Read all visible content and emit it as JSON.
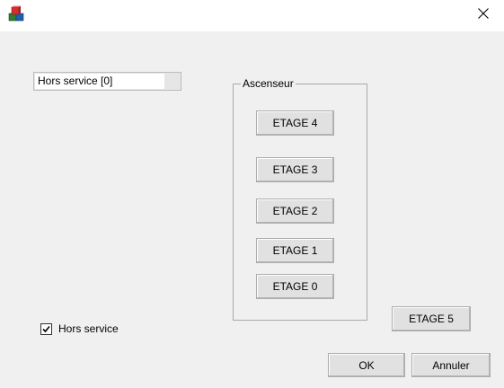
{
  "window": {
    "icon": "app-blocks-icon",
    "close_icon": "close-icon"
  },
  "status_field": {
    "value": "Hors service [0]"
  },
  "elevator_group": {
    "label": "Ascenseur",
    "buttons": [
      {
        "label": "ETAGE 4"
      },
      {
        "label": "ETAGE 3"
      },
      {
        "label": "ETAGE 2"
      },
      {
        "label": "ETAGE 1"
      },
      {
        "label": "ETAGE 0"
      }
    ]
  },
  "floor5_button": {
    "label": "ETAGE 5"
  },
  "out_of_service": {
    "label": "Hors service",
    "checked": true
  },
  "dialog_buttons": {
    "ok": "OK",
    "cancel": "Annuler"
  }
}
